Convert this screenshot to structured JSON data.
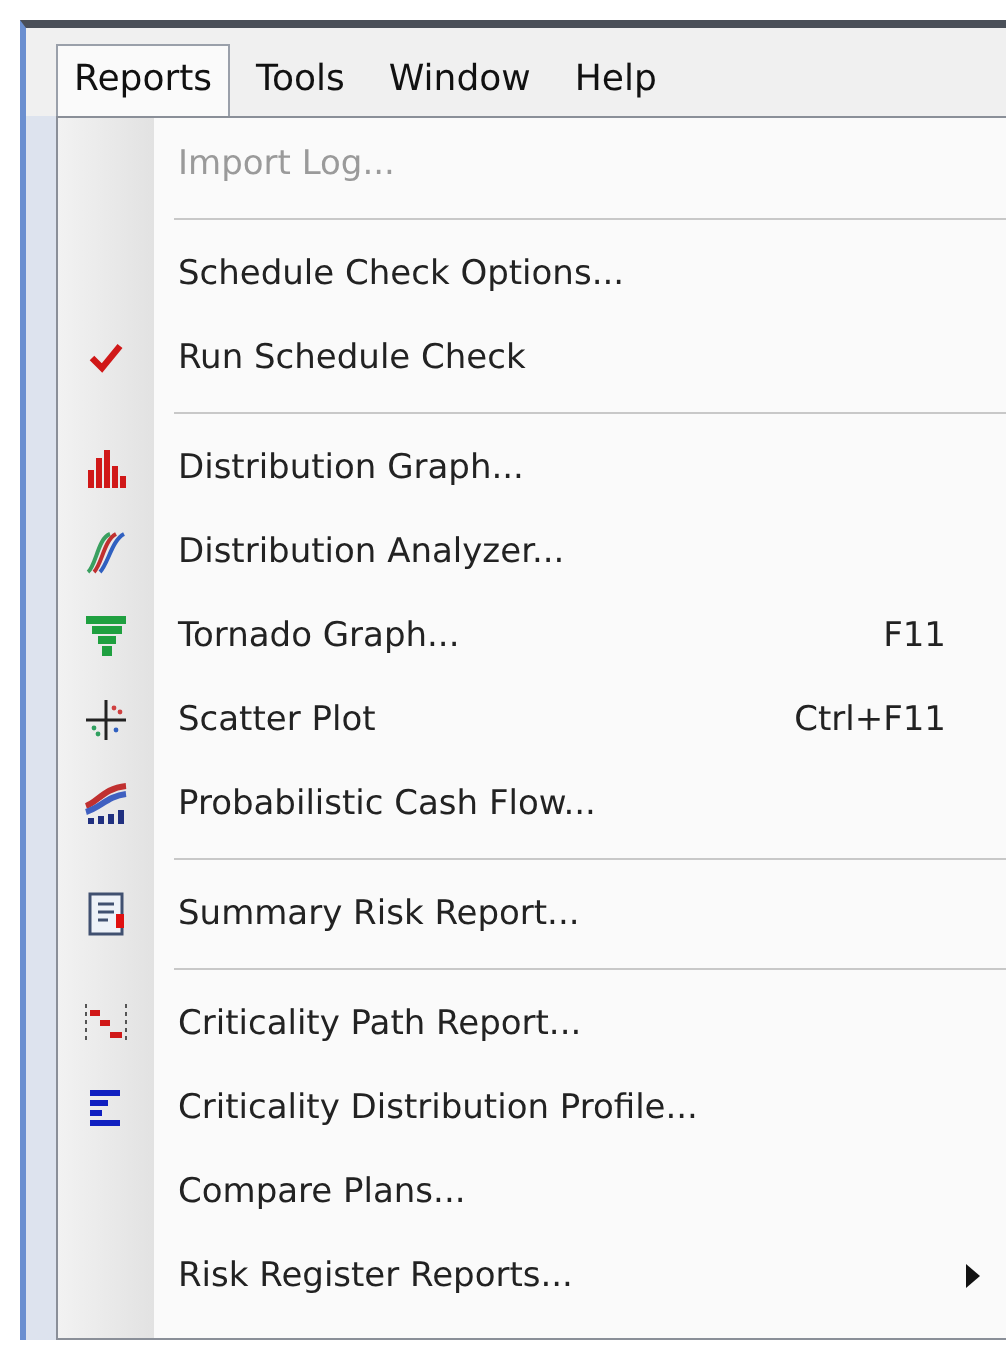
{
  "menubar": [
    {
      "label": "Reports",
      "selected": true
    },
    {
      "label": "Tools",
      "selected": false
    },
    {
      "label": "Window",
      "selected": false
    },
    {
      "label": "Help",
      "selected": false
    }
  ],
  "menu": {
    "items": [
      {
        "kind": "item",
        "label": "Import Log...",
        "disabled": true,
        "checked": false
      },
      {
        "kind": "separator"
      },
      {
        "kind": "item",
        "label": "Schedule Check Options...",
        "disabled": false,
        "checked": false
      },
      {
        "kind": "item",
        "label": "Run Schedule Check",
        "disabled": false,
        "checked": true
      },
      {
        "kind": "separator"
      },
      {
        "kind": "item",
        "label": "Distribution Graph...",
        "disabled": false,
        "checked": false
      },
      {
        "kind": "item",
        "label": "Distribution Analyzer...",
        "disabled": false,
        "checked": false
      },
      {
        "kind": "item",
        "label": "Tornado Graph...",
        "shortcut": "F11",
        "disabled": false,
        "checked": false
      },
      {
        "kind": "item",
        "label": "Scatter Plot",
        "shortcut": "Ctrl+F11",
        "disabled": false,
        "checked": false
      },
      {
        "kind": "item",
        "label": "Probabilistic Cash Flow...",
        "disabled": false,
        "checked": false
      },
      {
        "kind": "separator"
      },
      {
        "kind": "item",
        "label": "Summary Risk Report...",
        "disabled": false,
        "checked": false
      },
      {
        "kind": "separator"
      },
      {
        "kind": "item",
        "label": "Criticality Path Report...",
        "disabled": false,
        "checked": false
      },
      {
        "kind": "item",
        "label": "Criticality Distribution Profile...",
        "disabled": false,
        "checked": false
      },
      {
        "kind": "item",
        "label": "Compare Plans...",
        "disabled": false,
        "checked": false
      },
      {
        "kind": "item",
        "label": "Risk Register Reports...",
        "disabled": false,
        "checked": false,
        "submenu": true
      }
    ]
  }
}
